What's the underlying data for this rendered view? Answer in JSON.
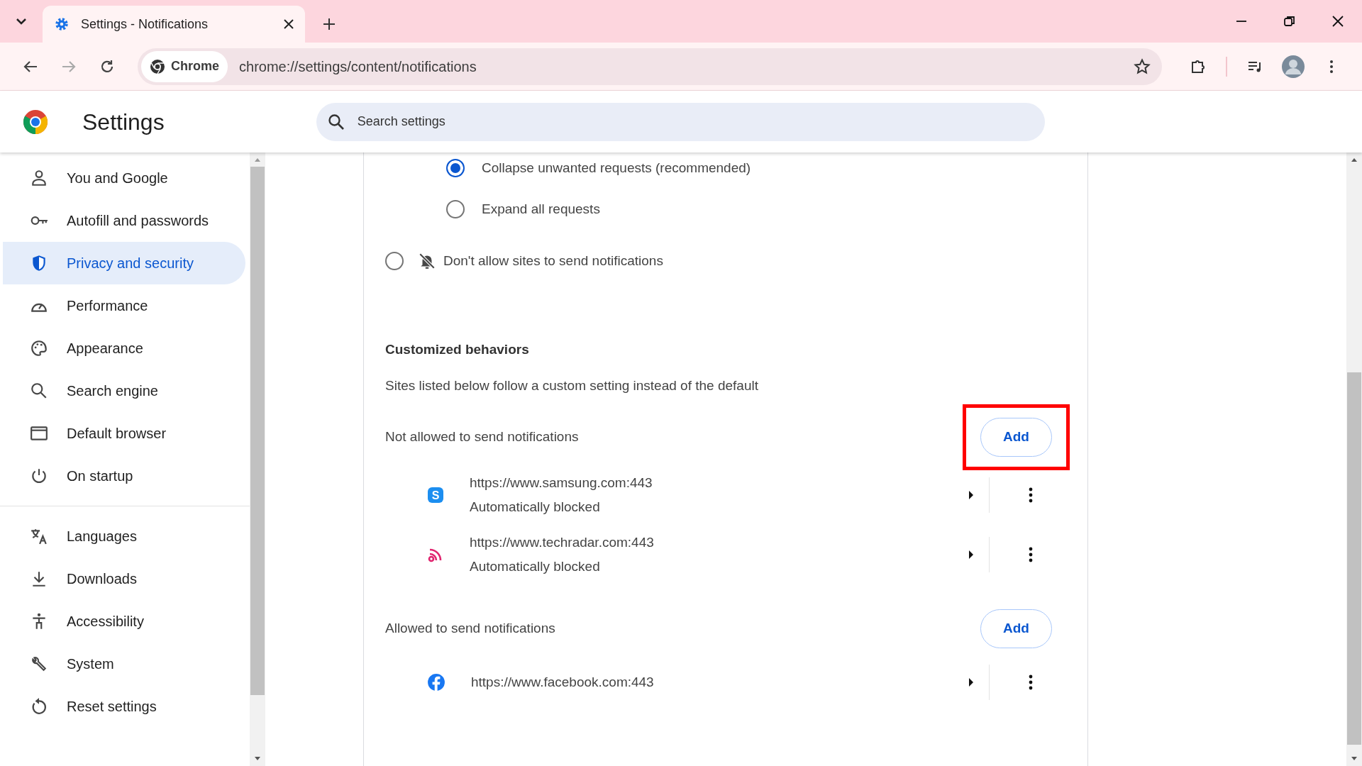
{
  "browser": {
    "tabs": [
      {
        "title": "Settings - Notifications",
        "selected": true
      }
    ],
    "chip": "Chrome",
    "url": "chrome://settings/content/notifications"
  },
  "header": {
    "title": "Settings",
    "search": {
      "placeholder": "Search settings"
    }
  },
  "sidebar": {
    "groups": [
      [
        {
          "label": "You and Google",
          "selected": false,
          "kind": "person"
        },
        {
          "label": "Autofill and passwords",
          "selected": false,
          "kind": "key"
        },
        {
          "label": "Privacy and security",
          "selected": true,
          "kind": "shield"
        },
        {
          "label": "Performance",
          "selected": false,
          "kind": "gauge"
        },
        {
          "label": "Appearance",
          "selected": false,
          "kind": "palette"
        },
        {
          "label": "Search engine",
          "selected": false,
          "kind": "search"
        },
        {
          "label": "Default browser",
          "selected": false,
          "kind": "window"
        },
        {
          "label": "On startup",
          "selected": false,
          "kind": "power"
        }
      ],
      [
        {
          "label": "Languages",
          "selected": false,
          "kind": "translate"
        },
        {
          "label": "Downloads",
          "selected": false,
          "kind": "download"
        },
        {
          "label": "Accessibility",
          "selected": false,
          "kind": "figure"
        },
        {
          "label": "System",
          "selected": false,
          "kind": "wrench"
        },
        {
          "label": "Reset settings",
          "selected": false,
          "kind": "reset"
        }
      ]
    ]
  },
  "content": {
    "sub_options": [
      {
        "label": "Collapse unwanted requests (recommended)",
        "selected": true
      },
      {
        "label": "Expand all requests",
        "selected": false
      }
    ],
    "options": [
      {
        "label": "Don't allow sites to send notifications",
        "selected": false
      }
    ],
    "customized": {
      "title": "Customized behaviors",
      "description": "Sites listed below follow a custom setting instead of the default",
      "groups": [
        {
          "title": "Not allowed to send notifications",
          "add_button": "Add",
          "highlighted": true,
          "sites": [
            {
              "url": "https://www.samsung.com:443",
              "status": "Automatically blocked",
              "kind": "letter",
              "favicon_text": "S"
            },
            {
              "url": "https://www.techradar.com:443",
              "status": "Automatically blocked",
              "kind": "feed"
            }
          ]
        },
        {
          "title": "Allowed to send notifications",
          "add_button": "Add",
          "highlighted": false,
          "sites": [
            {
              "url": "https://www.facebook.com:443",
              "kind": "round"
            }
          ]
        }
      ]
    }
  }
}
